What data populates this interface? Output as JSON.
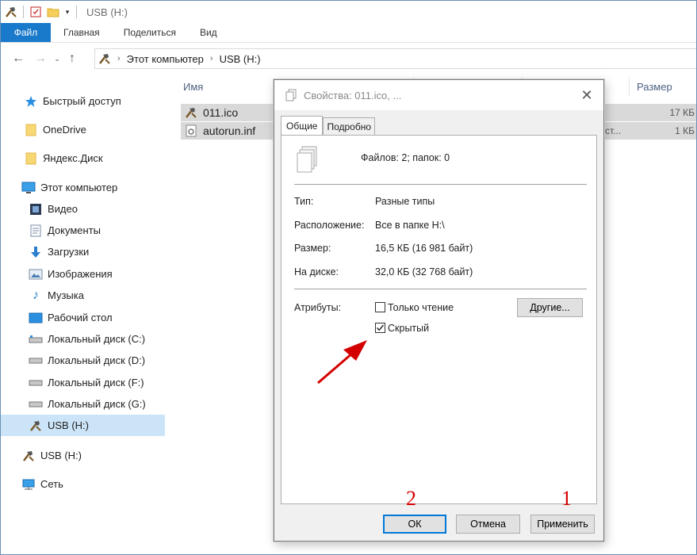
{
  "window": {
    "title": "USB (H:)"
  },
  "ribbon": {
    "tabs": [
      "Файл",
      "Главная",
      "Поделиться",
      "Вид"
    ]
  },
  "address": {
    "crumbs": [
      "Этот компьютер",
      "USB (H:)"
    ]
  },
  "sidebar": {
    "items": [
      {
        "label": "Быстрый доступ",
        "icon": "star-icon"
      },
      {
        "label": "OneDrive",
        "icon": "folder-icon"
      },
      {
        "label": "Яндекс.Диск",
        "icon": "folder-icon"
      },
      {
        "label": "Этот компьютер",
        "icon": "computer-icon"
      },
      {
        "label": "Видео",
        "icon": "video-icon"
      },
      {
        "label": "Документы",
        "icon": "documents-icon"
      },
      {
        "label": "Загрузки",
        "icon": "download-icon"
      },
      {
        "label": "Изображения",
        "icon": "pictures-icon"
      },
      {
        "label": "Музыка",
        "icon": "music-icon"
      },
      {
        "label": "Рабочий стол",
        "icon": "desktop-icon"
      },
      {
        "label": "Локальный диск (C:)",
        "icon": "drive-icon"
      },
      {
        "label": "Локальный диск (D:)",
        "icon": "drive-icon"
      },
      {
        "label": "Локальный диск (F:)",
        "icon": "drive-icon"
      },
      {
        "label": "Локальный диск (G:)",
        "icon": "drive-icon"
      },
      {
        "label": "USB (H:)",
        "icon": "usb-drive-icon",
        "selected": true
      },
      {
        "label": "USB (H:)",
        "icon": "usb-drive-icon"
      },
      {
        "label": "Сеть",
        "icon": "network-icon"
      }
    ]
  },
  "filelist": {
    "columns": {
      "name": "Имя",
      "size": "Размер"
    },
    "files": [
      {
        "name": "011.ico",
        "size": "17 КБ",
        "type": ""
      },
      {
        "name": "autorun.inf",
        "size": "1 КБ",
        "type": "ст..."
      }
    ]
  },
  "dialog": {
    "title": "Свойства: 011.ico, ...",
    "tabs": [
      "Общие",
      "Подробно"
    ],
    "summary": "Файлов: 2; папок: 0",
    "rows": [
      {
        "label": "Тип:",
        "value": "Разные типы"
      },
      {
        "label": "Расположение:",
        "value": "Все в папке H:\\"
      },
      {
        "label": "Размер:",
        "value": "16,5 КБ (16 981 байт)"
      },
      {
        "label": "На диске:",
        "value": "32,0 КБ (32 768 байт)"
      }
    ],
    "attributes_label": "Атрибуты:",
    "readonly": {
      "label": "Только чтение",
      "checked": false
    },
    "hidden": {
      "label": "Скрытый",
      "checked": true
    },
    "other_button": "Другие...",
    "buttons": {
      "ok": "ОК",
      "cancel": "Отмена",
      "apply": "Применить"
    }
  },
  "annotations": {
    "num_ok": "2",
    "num_apply": "1",
    "color": "#d40000"
  }
}
